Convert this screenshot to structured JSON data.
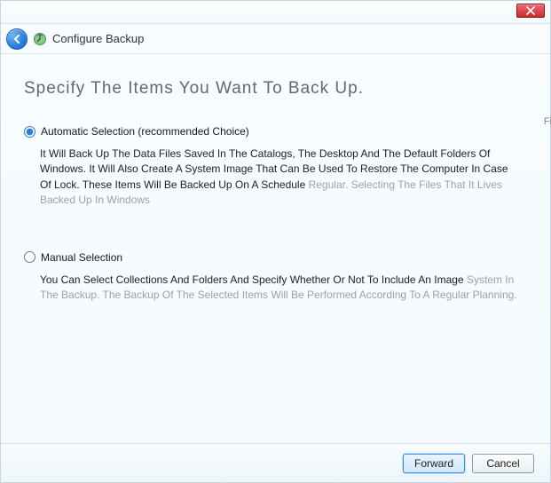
{
  "titlebar": {
    "close_label": "Close"
  },
  "header": {
    "title": "Configure Backup"
  },
  "page": {
    "heading": "Specify The Items You Want To Back Up."
  },
  "options": {
    "auto": {
      "label": "Automatic Selection (recommended Choice)",
      "desc_dark": "It Will Back Up The Data Files Saved In The Catalogs, The Desktop And The Default Folders Of Windows. It Will Also Create A System Image That Can Be Used To Restore The Computer In Case Of Lock. These Items Will Be Backed Up On A Schedule ",
      "desc_gray": "Regular. Selecting The Files That It Lives Backed Up In Windows"
    },
    "manual": {
      "label": "Manual Selection",
      "desc_dark": "You Can Select Collections And Folders And Specify Whether Or Not To Include An Image ",
      "desc_gray": "System In The Backup. The Backup Of The Selected Items Will Be Performed According To A Regular Planning."
    }
  },
  "footer": {
    "forward": "Forward",
    "cancel": "Cancel"
  },
  "side_stub": "Fi"
}
